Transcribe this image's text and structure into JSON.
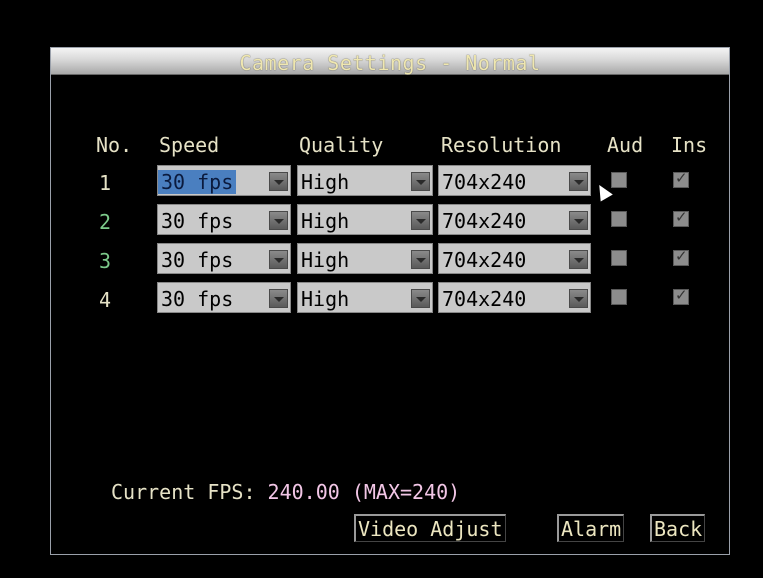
{
  "window": {
    "title": "Camera Settings - Normal"
  },
  "columns": {
    "no": "No.",
    "speed": "Speed",
    "quality": "Quality",
    "resolution": "Resolution",
    "aud": "Aud",
    "ins": "Ins"
  },
  "rows": [
    {
      "no": "1",
      "speed": "30 fps",
      "quality": "High",
      "resolution": "704x240",
      "aud": false,
      "ins": true
    },
    {
      "no": "2",
      "speed": "30 fps",
      "quality": "High",
      "resolution": "704x240",
      "aud": false,
      "ins": true
    },
    {
      "no": "3",
      "speed": "30 fps",
      "quality": "High",
      "resolution": "704x240",
      "aud": false,
      "ins": true
    },
    {
      "no": "4",
      "speed": "30 fps",
      "quality": "High",
      "resolution": "704x240",
      "aud": false,
      "ins": true
    }
  ],
  "status": {
    "fps_label": "Current FPS: ",
    "fps_value": "240.00 (MAX=240)"
  },
  "buttons": {
    "video_adjust": "Video Adjust",
    "alarm": "Alarm",
    "back": "Back"
  },
  "colors": {
    "text_cream": "#e6e2c6",
    "selected_blue": "#4a7fc0",
    "row_green": "#7cc98a",
    "fps_value_pink": "#f2c6e6"
  }
}
